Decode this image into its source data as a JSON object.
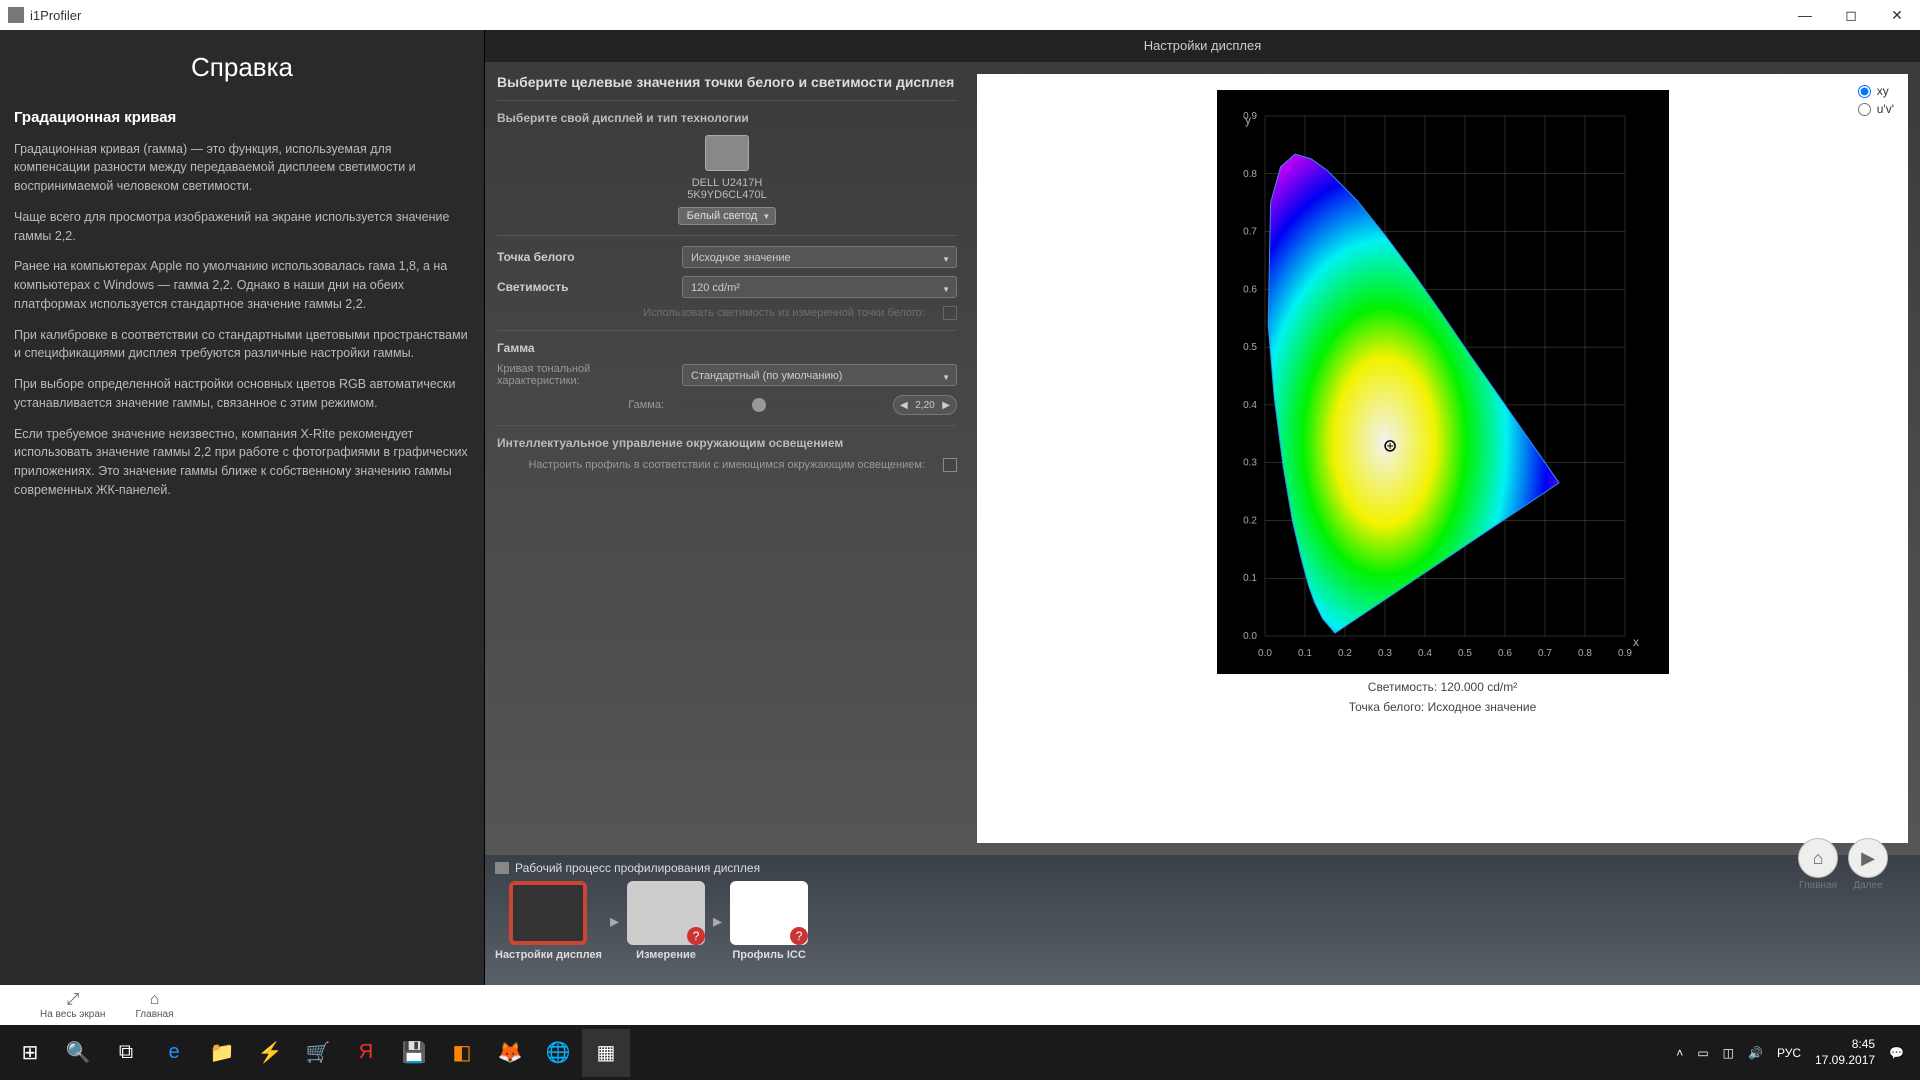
{
  "window": {
    "title": "i1Profiler"
  },
  "help": {
    "title": "Справка",
    "heading": "Градационная кривая",
    "p1": "Градационная кривая (гамма) — это функция, используемая для компенсации разности между передаваемой дисплеем светимости и воспринимаемой человеком светимости.",
    "p2": "Чаще всего для просмотра изображений на экране используется значение гаммы 2,2.",
    "p3": "Ранее на компьютерах Apple по умолчанию использовалась гама 1,8, а на компьютерах c Windows — гамма 2,2. Однако в наши дни на обеих платформах используется стандартное значение гаммы 2,2.",
    "p4": "При калибровке в соответствии со стандартными цветовыми пространствами и спецификациями дисплея требуются различные настройки гаммы.",
    "p5": "При выборе определенной настройки основных цветов RGB автоматически устанавливается значение гаммы, связанное с этим режимом.",
    "p6": "Если требуемое значение неизвестно, компания X-Rite рекомендует использовать значение гаммы 2,2 при работе с фотографиями в графических приложениях. Это значение гаммы ближе к собственному значению гаммы современных ЖК-панелей."
  },
  "page": {
    "title": "Настройки дисплея"
  },
  "settings": {
    "heading": "Выберите целевые значения точки белого и светимости дисплея",
    "choose_display": "Выберите свой дисплей и тип технологии",
    "monitor_name": "DELL U2417H",
    "monitor_serial": "5K9YD6CL470L",
    "backlight": "Белый светод",
    "white_point_label": "Точка белого",
    "white_point_value": "Исходное значение",
    "luminance_label": "Светимость",
    "luminance_value": "120 cd/m²",
    "lum_checkbox_label": "Использовать светимость из измеренной точки белого:",
    "gamma_section": "Гамма",
    "curve_label": "Кривая тональной характеристики:",
    "curve_value": "Стандартный (по умолчанию)",
    "gamma_label": "Гамма:",
    "gamma_value": "2,20",
    "ambient_section": "Интеллектуальное управление окружающим освещением",
    "ambient_label": "Настроить профиль в соответствии с имеющимся окружающим освещением:"
  },
  "diagram": {
    "radio_xy": "xy",
    "radio_uv": "u'v'",
    "caption1": "Светимость: 120.000 cd/m²",
    "caption2": "Точка белого: Исходное значение"
  },
  "chart_data": {
    "type": "area",
    "title": "CIE xy chromaticity diagram",
    "xlabel": "x",
    "ylabel": "y",
    "xlim": [
      0.0,
      0.9
    ],
    "ylim": [
      0.0,
      0.9
    ],
    "x_ticks": [
      0.0,
      0.1,
      0.2,
      0.3,
      0.4,
      0.5,
      0.6,
      0.7,
      0.8,
      0.9
    ],
    "y_ticks": [
      0.0,
      0.1,
      0.2,
      0.3,
      0.4,
      0.5,
      0.6,
      0.7,
      0.8,
      0.9
    ],
    "white_point": {
      "x": 0.3127,
      "y": 0.329
    },
    "spectral_locus": [
      [
        0.175,
        0.005
      ],
      [
        0.144,
        0.03
      ],
      [
        0.124,
        0.058
      ],
      [
        0.109,
        0.087
      ],
      [
        0.091,
        0.133
      ],
      [
        0.068,
        0.201
      ],
      [
        0.045,
        0.295
      ],
      [
        0.023,
        0.413
      ],
      [
        0.008,
        0.538
      ],
      [
        0.014,
        0.75
      ],
      [
        0.039,
        0.812
      ],
      [
        0.075,
        0.834
      ],
      [
        0.115,
        0.826
      ],
      [
        0.155,
        0.806
      ],
      [
        0.23,
        0.754
      ],
      [
        0.302,
        0.692
      ],
      [
        0.374,
        0.625
      ],
      [
        0.445,
        0.555
      ],
      [
        0.512,
        0.487
      ],
      [
        0.575,
        0.425
      ],
      [
        0.628,
        0.372
      ],
      [
        0.665,
        0.335
      ],
      [
        0.7,
        0.3
      ],
      [
        0.715,
        0.285
      ],
      [
        0.735,
        0.265
      ]
    ]
  },
  "nav": {
    "home": "Главная",
    "next": "Далее"
  },
  "workflow": {
    "title": "Рабочий процесс профилирования дисплея",
    "step1": "Настройки дисплея",
    "step2": "Измерение",
    "step3": "Профиль ICC"
  },
  "bottom": {
    "fullscreen": "На весь экран",
    "home": "Главная"
  },
  "taskbar": {
    "lang": "РУС",
    "time": "8:45",
    "date": "17.09.2017"
  }
}
